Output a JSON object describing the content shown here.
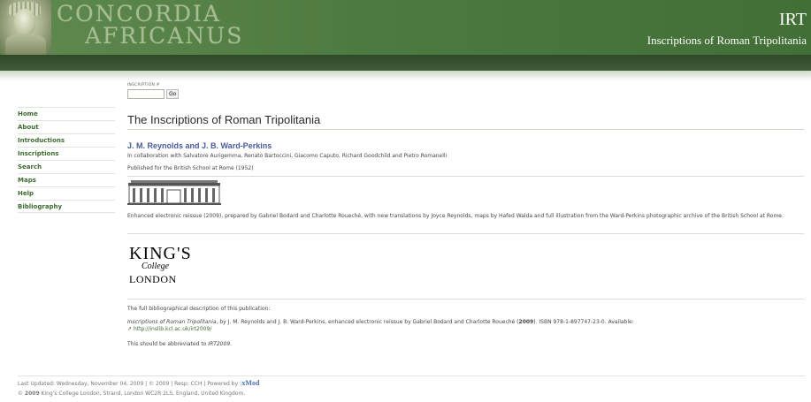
{
  "header": {
    "brand_line1": "CONCORDIA",
    "brand_line2": "AFRICANUS",
    "site_short": "IRT",
    "site_title": "Inscriptions of Roman Tripolitania",
    "colors": {
      "header_green": "#4d7a40",
      "dark_bar": "#2f4a2a"
    }
  },
  "search": {
    "label": "INSCRIPTION #",
    "input_value": "",
    "button": "Go"
  },
  "nav": {
    "items": [
      {
        "label": "Home"
      },
      {
        "label": "About"
      },
      {
        "label": "Introductions"
      },
      {
        "label": "Inscriptions"
      },
      {
        "label": "Search"
      },
      {
        "label": "Maps"
      },
      {
        "label": "Help"
      },
      {
        "label": "Bibliography"
      }
    ]
  },
  "main": {
    "title": "The Inscriptions of Roman Tripolitania",
    "authors": "J. M. Reynolds and J. B. Ward-Perkins",
    "collaboration": "In collaboration with Salvatore Aurigemma, Renato Bartoccini, Giacomo Caputo, Richard Goodchild and Pietro Romanelli",
    "published": "Published for the British School at Rome (1952)",
    "reissue": "Enhanced electronic reissue (2009), prepared by Gabriel Bodard and Charlotte Roueché, with new translations by Joyce Reynolds, maps by Hafed Walda and full illustration from the Ward-Perkins photographic archive of the British School at Rome.",
    "kcl_logo": {
      "line1": "KING'S",
      "line2": "College",
      "line3": "LONDON"
    },
    "bib_intro": "The full bibliographical description of this publication:",
    "bib_title": "Inscriptions of Roman Tripolitania",
    "bib_rest_1": ", by J. M. Reynolds and J. B. Ward-Perkins, enhanced electronic reissue by Gabriel Bodard and Charlotte Roueché (",
    "bib_year": "2009",
    "bib_rest_2": "). ISBN 978-1-897747-23-0. Available:",
    "bib_link": "http://inslib.kcl.ac.uk/irt2009/",
    "abbrev_pre": "This should be abbreviated to ",
    "abbrev": "IRT2009."
  },
  "footer": {
    "updated": "Last Updated: Wednesday, November 04, 2009",
    "copy": "© 2009",
    "resp": "Resp: CCH",
    "powered": "Powered by",
    "xmod": "xMod",
    "line2_pre": "© ",
    "line2_year": "2009",
    "line2_rest": " King's College London, Strand, London WC2R 2LS, England, United Kingdom."
  }
}
